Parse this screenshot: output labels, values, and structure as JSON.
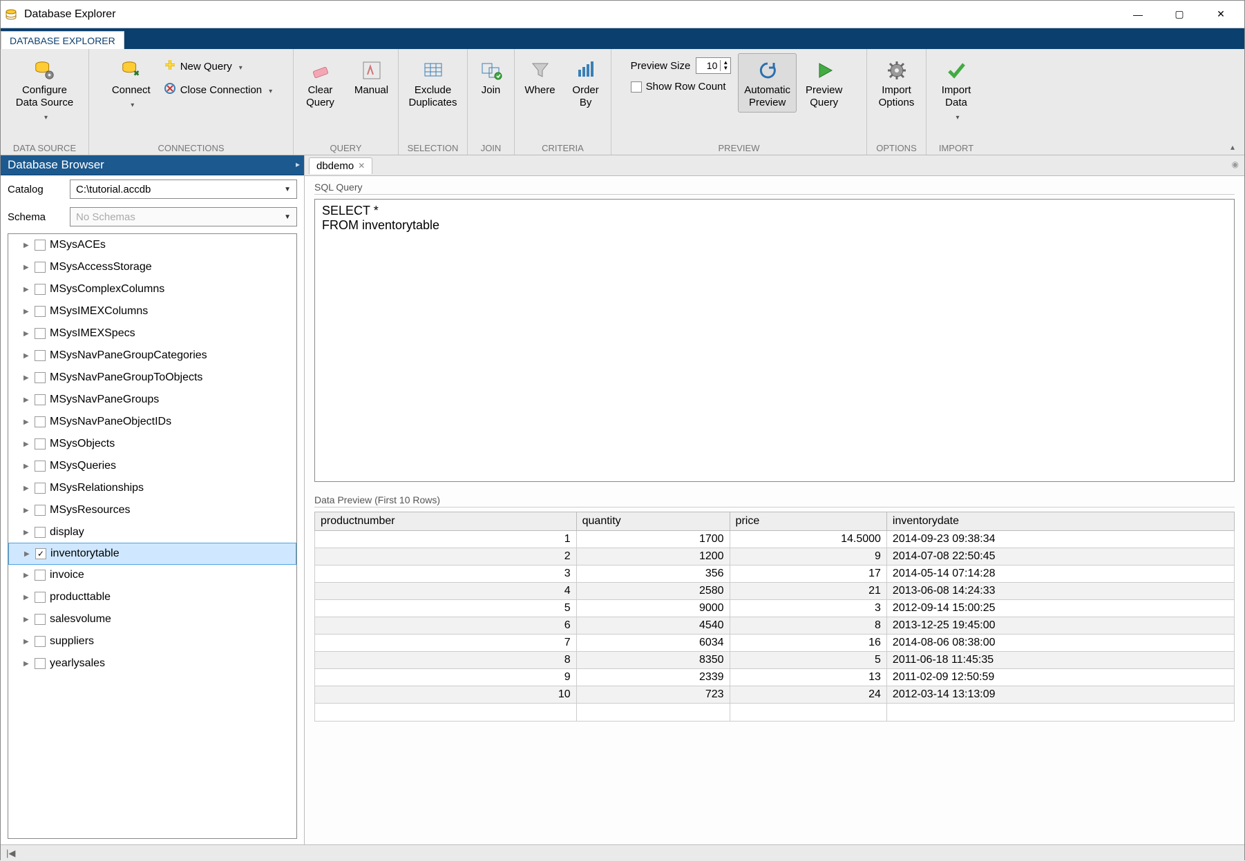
{
  "app": {
    "title": "Database Explorer"
  },
  "tabstrip": {
    "tab": "DATABASE EXPLORER"
  },
  "ribbon": {
    "data_source": {
      "configure": "Configure\nData Source",
      "label": "DATA SOURCE"
    },
    "connections": {
      "connect": "Connect",
      "new_query": "New Query",
      "close_conn": "Close Connection",
      "label": "CONNECTIONS"
    },
    "query": {
      "clear": "Clear\nQuery",
      "manual": "Manual",
      "label": "QUERY"
    },
    "selection": {
      "exclude": "Exclude\nDuplicates",
      "label": "SELECTION"
    },
    "join": {
      "join": "Join",
      "label": "JOIN"
    },
    "criteria": {
      "where": "Where",
      "orderby": "Order\nBy",
      "label": "CRITERIA"
    },
    "preview": {
      "size_label": "Preview Size",
      "size_value": "10",
      "show_row_count": "Show Row Count",
      "auto": "Automatic\nPreview",
      "run": "Preview\nQuery",
      "label": "PREVIEW"
    },
    "options": {
      "import_opts": "Import\nOptions",
      "label": "OPTIONS"
    },
    "import": {
      "import_data": "Import\nData",
      "label": "IMPORT"
    }
  },
  "browser": {
    "title": "Database Browser",
    "catalog_label": "Catalog",
    "catalog_value": "C:\\tutorial.accdb",
    "schema_label": "Schema",
    "schema_placeholder": "No Schemas",
    "tables": [
      {
        "name": "MSysACEs",
        "checked": false
      },
      {
        "name": "MSysAccessStorage",
        "checked": false
      },
      {
        "name": "MSysComplexColumns",
        "checked": false
      },
      {
        "name": "MSysIMEXColumns",
        "checked": false
      },
      {
        "name": "MSysIMEXSpecs",
        "checked": false
      },
      {
        "name": "MSysNavPaneGroupCategories",
        "checked": false
      },
      {
        "name": "MSysNavPaneGroupToObjects",
        "checked": false
      },
      {
        "name": "MSysNavPaneGroups",
        "checked": false
      },
      {
        "name": "MSysNavPaneObjectIDs",
        "checked": false
      },
      {
        "name": "MSysObjects",
        "checked": false
      },
      {
        "name": "MSysQueries",
        "checked": false
      },
      {
        "name": "MSysRelationships",
        "checked": false
      },
      {
        "name": "MSysResources",
        "checked": false
      },
      {
        "name": "display",
        "checked": false
      },
      {
        "name": "inventorytable",
        "checked": true,
        "selected": true
      },
      {
        "name": "invoice",
        "checked": false
      },
      {
        "name": "producttable",
        "checked": false
      },
      {
        "name": "salesvolume",
        "checked": false
      },
      {
        "name": "suppliers",
        "checked": false
      },
      {
        "name": "yearlysales",
        "checked": false
      }
    ]
  },
  "doc": {
    "tab_name": "dbdemo"
  },
  "sql": {
    "label": "SQL Query",
    "text": "SELECT *\nFROM inventorytable"
  },
  "preview": {
    "label": "Data Preview (First 10 Rows)",
    "columns": [
      "productnumber",
      "quantity",
      "price",
      "inventorydate"
    ],
    "rows": [
      [
        "1",
        "1700",
        "14.5000",
        "2014-09-23 09:38:34"
      ],
      [
        "2",
        "1200",
        "9",
        "2014-07-08 22:50:45"
      ],
      [
        "3",
        "356",
        "17",
        "2014-05-14 07:14:28"
      ],
      [
        "4",
        "2580",
        "21",
        "2013-06-08 14:24:33"
      ],
      [
        "5",
        "9000",
        "3",
        "2012-09-14 15:00:25"
      ],
      [
        "6",
        "4540",
        "8",
        "2013-12-25 19:45:00"
      ],
      [
        "7",
        "6034",
        "16",
        "2014-08-06 08:38:00"
      ],
      [
        "8",
        "8350",
        "5",
        "2011-06-18 11:45:35"
      ],
      [
        "9",
        "2339",
        "13",
        "2011-02-09 12:50:59"
      ],
      [
        "10",
        "723",
        "24",
        "2012-03-14 13:13:09"
      ]
    ]
  },
  "status": {
    "left": "|◀"
  }
}
